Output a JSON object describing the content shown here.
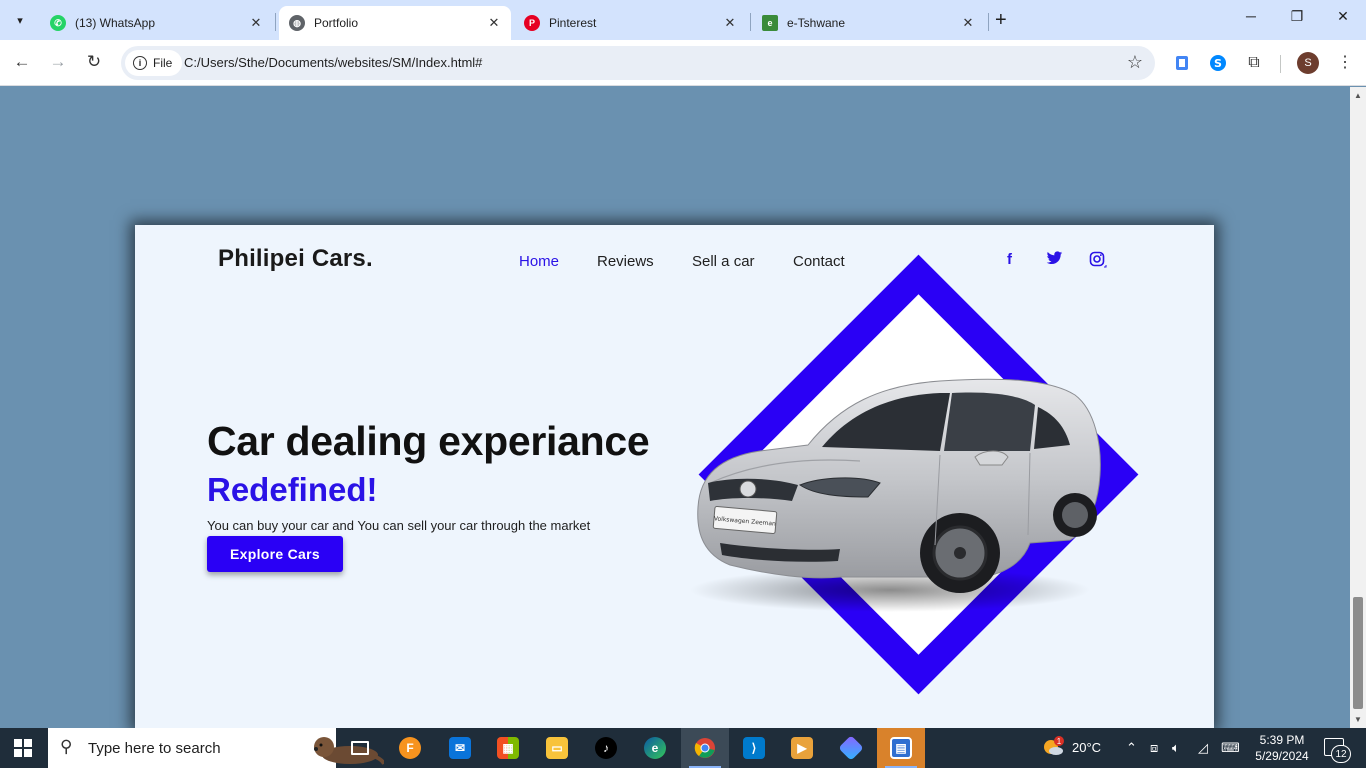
{
  "browser": {
    "tabs": [
      {
        "title": "(13) WhatsApp",
        "favicon": "whatsapp-icon",
        "color": "#25d366",
        "active": false
      },
      {
        "title": "Portfolio",
        "favicon": "globe-icon",
        "color": "#5f6368",
        "active": true
      },
      {
        "title": "Pinterest",
        "favicon": "pinterest-icon",
        "color": "#e60023",
        "active": false
      },
      {
        "title": "e-Tshwane",
        "favicon": "etshwane-icon",
        "color": "#3a8b3a",
        "active": false
      }
    ],
    "site_chip": "File",
    "url": "C:/Users/Sthe/Documents/websites/SM/Index.html#",
    "profile_initial": "S"
  },
  "page": {
    "brand": "Philipei Cars.",
    "nav": [
      "Home",
      "Reviews",
      "Sell a car",
      "Contact"
    ],
    "social": [
      "facebook-icon",
      "twitter-icon",
      "instagram-icon"
    ],
    "hero_title": "Car dealing experiance",
    "hero_accent": "Redefined!",
    "hero_text": "You can buy your car and You can sell your car through the market",
    "cta_label": "Explore Cars",
    "accent_color": "#2a12e6",
    "plate_text": "Volkswagen Zeeman"
  },
  "taskbar": {
    "search_placeholder": "Type here to search",
    "weather": "20°C",
    "time": "5:39 PM",
    "date": "5/29/2024",
    "notifications": "12",
    "weather_badge": "1"
  }
}
